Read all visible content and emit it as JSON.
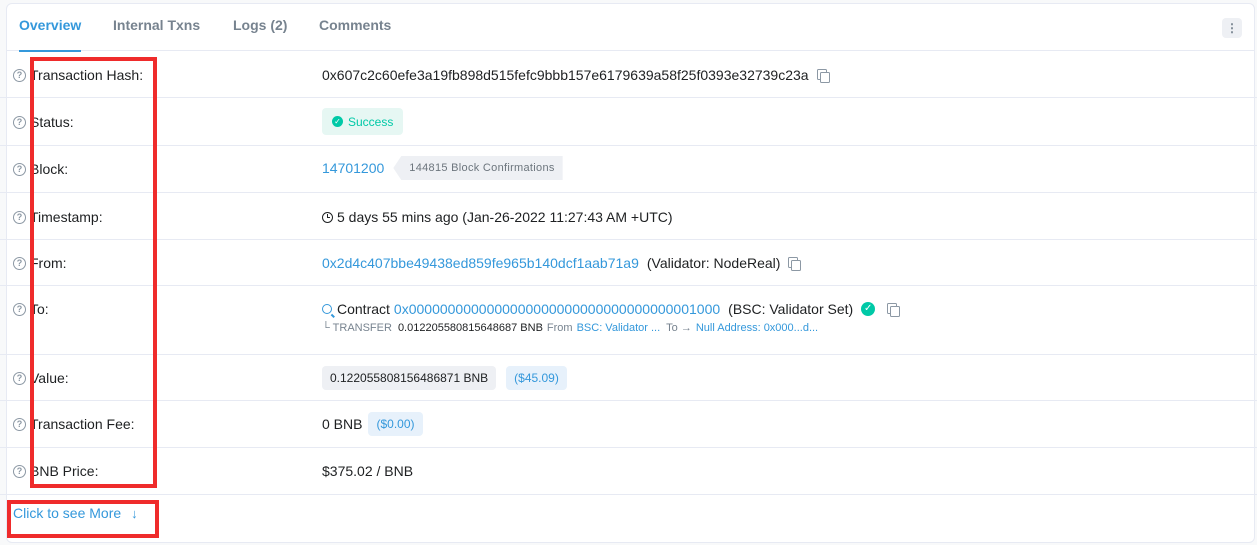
{
  "tabs": [
    "Overview",
    "Internal Txns",
    "Logs (2)",
    "Comments"
  ],
  "menu_label": "⋮",
  "rows": {
    "hash": {
      "label": "Transaction Hash:",
      "value": "0x607c2c60efe3a19fb898d515fefc9bbb157e6179639a58f25f0393e32739c23a"
    },
    "status": {
      "label": "Status:",
      "value": "Success"
    },
    "block": {
      "label": "Block:",
      "value": "14701200",
      "confirmations": "144815 Block Confirmations"
    },
    "timestamp": {
      "label": "Timestamp:",
      "value": "5 days 55 mins ago (Jan-26-2022 11:27:43 AM +UTC)"
    },
    "from": {
      "label": "From:",
      "address": "0x2d4c407bbe49438ed859fe965b140dcf1aab71a9",
      "tag": "(Validator: NodeReal)"
    },
    "to": {
      "label": "To:",
      "prefix": "Contract",
      "address": "0x0000000000000000000000000000000000001000",
      "tag": "(BSC: Validator Set)",
      "transfer": {
        "type": "└ TRANSFER",
        "amount": "0.012205580815648687 BNB",
        "from_label": "From",
        "from": "BSC: Validator ...",
        "to_label": "To →",
        "to": "Null Address: 0x000...d..."
      }
    },
    "value": {
      "label": "Value:",
      "amount": "0.122055808156486871 BNB",
      "usd": "($45.09)"
    },
    "fee": {
      "label": "Transaction Fee:",
      "amount": "0 BNB",
      "usd": "($0.00)"
    },
    "price": {
      "label": "BNB Price:",
      "value": "$375.02 / BNB"
    }
  },
  "see_more": {
    "label": "Click to see More",
    "arrow": "↓"
  },
  "colors": {
    "accent": "#3498db",
    "success": "#00c9a7",
    "highlight": "#ef2b2b"
  }
}
